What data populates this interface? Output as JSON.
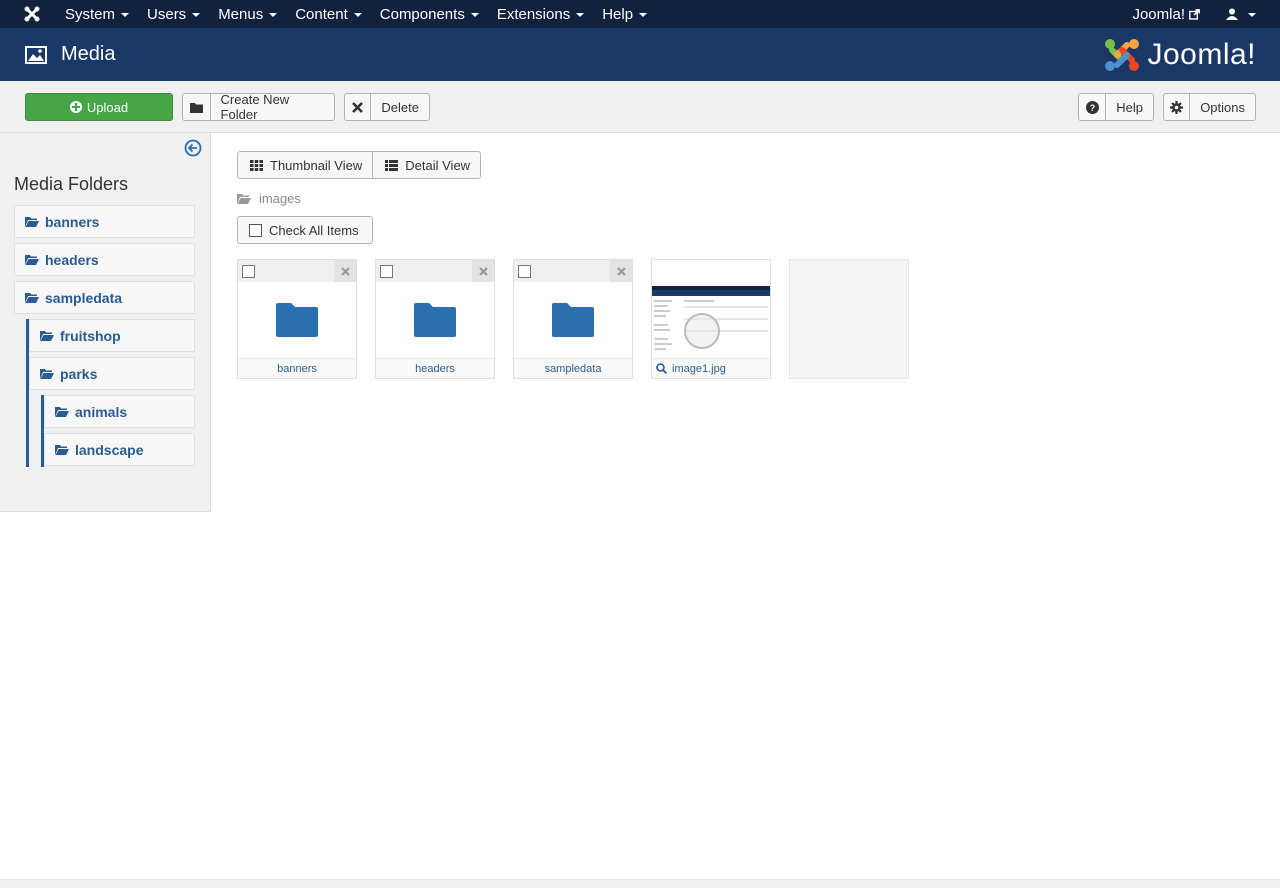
{
  "topnav": {
    "menu": [
      "System",
      "Users",
      "Menus",
      "Content",
      "Components",
      "Extensions",
      "Help"
    ],
    "site_link": "Joomla!"
  },
  "header": {
    "title": "Media",
    "brand": "Joomla!"
  },
  "toolbar": {
    "upload_label": "Upload",
    "create_folder_label": "Create New Folder",
    "delete_label": "Delete",
    "help_label": "Help",
    "options_label": "Options"
  },
  "sidebar": {
    "heading": "Media Folders",
    "folders": [
      {
        "label": "banners",
        "depth": 0
      },
      {
        "label": "headers",
        "depth": 0
      },
      {
        "label": "sampledata",
        "depth": 0
      },
      {
        "label": "fruitshop",
        "depth": 1
      },
      {
        "label": "parks",
        "depth": 1
      },
      {
        "label": "animals",
        "depth": 2
      },
      {
        "label": "landscape",
        "depth": 2
      }
    ]
  },
  "main": {
    "thumbnail_view_label": "Thumbnail View",
    "detail_view_label": "Detail View",
    "breadcrumb": "images",
    "check_all_label": "Check All Items",
    "items": [
      {
        "type": "folder",
        "label": "banners"
      },
      {
        "type": "folder",
        "label": "headers"
      },
      {
        "type": "folder",
        "label": "sampledata"
      },
      {
        "type": "image",
        "label": "image1.jpg"
      }
    ]
  },
  "colors": {
    "nav_bg": "#10223e",
    "header_bg": "#1a3867",
    "upload_green": "#46a546",
    "link_blue": "#2a5b91",
    "folder_blue": "#2a6fb0"
  }
}
